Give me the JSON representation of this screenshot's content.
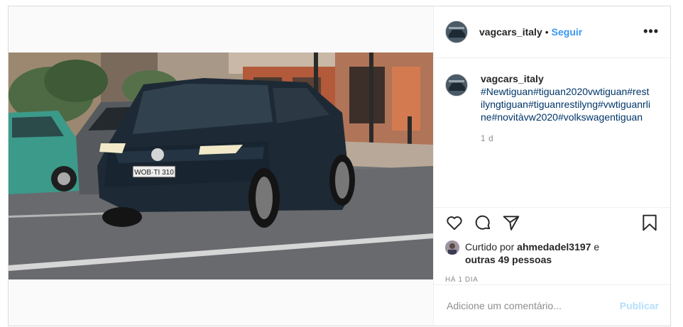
{
  "post": {
    "photo": {
      "plate_text": "WOB·TI 310",
      "background_plate": "W 480"
    },
    "header": {
      "username": "vagcars_italy",
      "separator": "•",
      "follow_label": "Seguir",
      "more_label": "•••",
      "more_icon": "more-options-icon"
    },
    "caption": {
      "username": "vagcars_italy",
      "text": "#Newtiguan#tiguan2020vwtiguan#restilyngtiguan#tiguanrestilyng#vwtiguanrline#novitàvw2020#volkswagentiguan",
      "time": "1 d"
    },
    "actions": {
      "like_icon": "heart-icon",
      "comment_icon": "comment-icon",
      "share_icon": "share-icon",
      "save_icon": "bookmark-icon"
    },
    "likes": {
      "prefix": "Curtido por",
      "user": "ahmedadel3197",
      "conjunction": "e",
      "others": "outras 49 pessoas"
    },
    "timestamp": "HÁ 1 DIA",
    "comment_box": {
      "placeholder": "Adicione um comentário...",
      "publish_label": "Publicar"
    },
    "colors": {
      "link_blue": "#3897f0",
      "hashtag": "#003569",
      "publish_disabled": "#b2dffc",
      "border": "#dbdbdb"
    }
  }
}
